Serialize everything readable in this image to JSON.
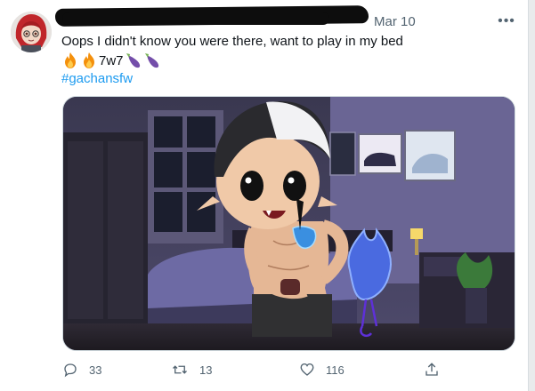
{
  "tweet": {
    "date": "Mar 10",
    "more_label": "•••",
    "text_line1": "Oops I didn't know you were there, want to play in my bed",
    "text_line2_middle": "7w7",
    "emoji_line": [
      "fire",
      "fire",
      "7w7",
      "eggplant",
      "eggplant"
    ],
    "hashtag": "#gachansfw"
  },
  "actions": {
    "reply_count": "33",
    "retweet_count": "13",
    "like_count": "116"
  },
  "colors": {
    "link": "#1d9bf0",
    "muted": "#536471",
    "text": "#0f1419"
  }
}
